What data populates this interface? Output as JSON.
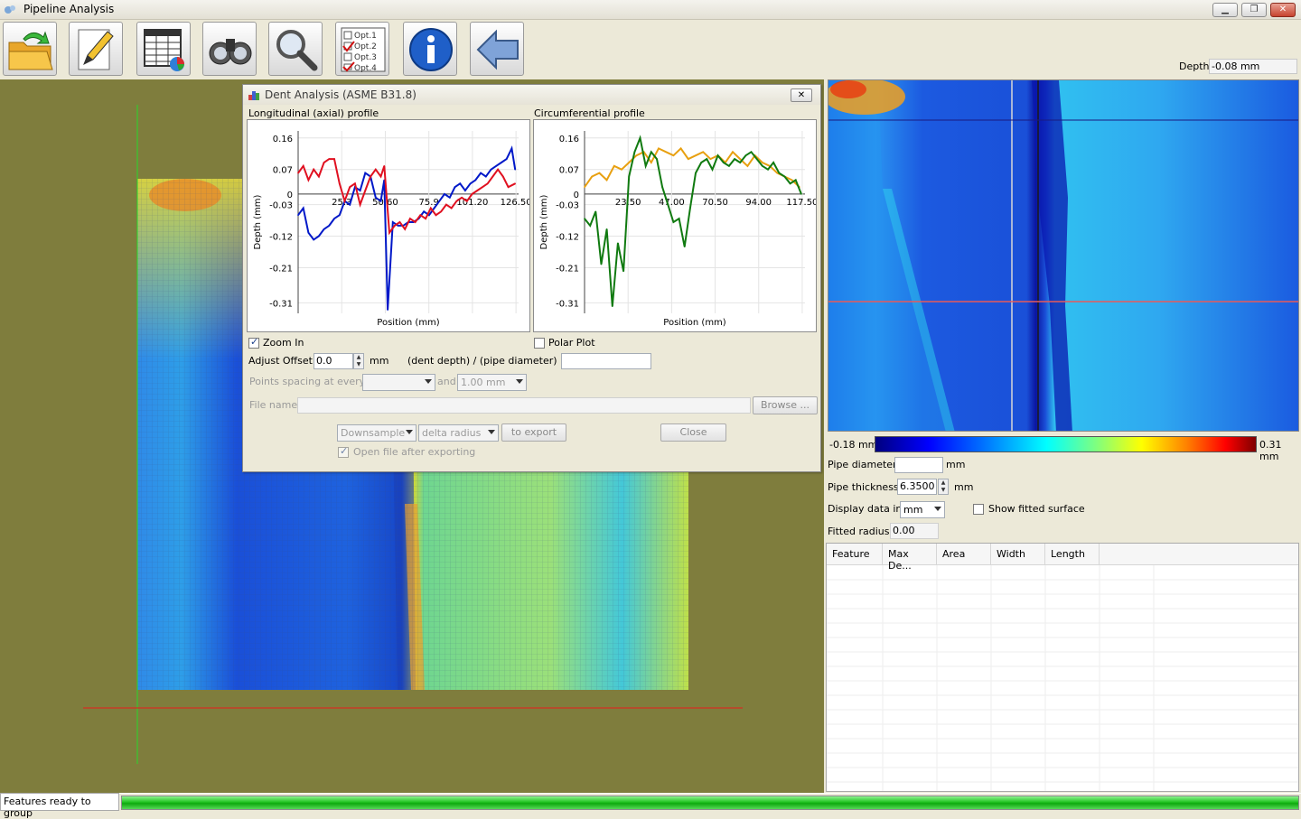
{
  "window": {
    "title": "Pipeline Analysis",
    "min_label": "▁",
    "max_label": "❐",
    "close_label": "✕"
  },
  "toolbar": {
    "buttons": [
      "open-folder-icon",
      "edit-pencil-icon",
      "table-report-icon",
      "binoculars-icon",
      "magnifier-icon",
      "options-checklist-icon",
      "info-icon",
      "back-arrow-icon"
    ],
    "options_labels": [
      "Opt.1",
      "Opt.2",
      "Opt.3",
      "Opt.4"
    ]
  },
  "depth": {
    "label": "Depth",
    "value": "-0.08 mm"
  },
  "dialog": {
    "title": "Dent Analysis (ASME B31.8)",
    "close_label": "✕",
    "long_title": "Longitudinal (axial) profile",
    "circ_title": "Circumferential profile",
    "y_label": "Depth (mm)",
    "x_label": "Position (mm)",
    "zoom_in_label": "Zoom In",
    "zoom_in_checked": true,
    "polar_plot_label": "Polar Plot",
    "polar_plot_checked": false,
    "adjust_offset_label": "Adjust Offset",
    "adjust_offset_value": "0.0",
    "adjust_offset_unit": "mm",
    "ratio_label": "(dent depth) / (pipe diameter) =",
    "ratio_value": "",
    "spacing_label": "Points spacing at every",
    "spacing_value": "",
    "and_label": "and",
    "spacing_value2": "1.00 mm",
    "file_name_label": "File name",
    "file_name_value": "",
    "browse_label": "Browse ...",
    "downsample_label": "Downsample",
    "delta_radius_label": "delta radius",
    "to_export_label": "to export",
    "close_button_label": "Close",
    "open_after_export_label": "Open file after exporting",
    "open_after_export_checked": true
  },
  "chart_data": [
    {
      "type": "line",
      "title": "Longitudinal (axial) profile",
      "xlabel": "Position (mm)",
      "ylabel": "Depth (mm)",
      "y_ticks": [
        "0.16",
        "0.07",
        "0",
        "-0.03",
        "-0.12",
        "-0.21",
        "-0.31"
      ],
      "x_ticks": [
        "25.3",
        "50.60",
        "75.9",
        "101.20",
        "126.50"
      ],
      "ylim": [
        -0.34,
        0.18
      ],
      "xlim": [
        0,
        128
      ],
      "series": [
        {
          "color": "#0018c8",
          "x": [
            0,
            3,
            6,
            9,
            12,
            15,
            18,
            21,
            24,
            27,
            30,
            33,
            36,
            39,
            42,
            45,
            48,
            50,
            52,
            55,
            58,
            61,
            64,
            67,
            70,
            73,
            76,
            79,
            82,
            85,
            88,
            91,
            94,
            97,
            100,
            103,
            106,
            109,
            112,
            115,
            118,
            121,
            124,
            126
          ],
          "values": [
            -0.06,
            -0.04,
            -0.11,
            -0.13,
            -0.12,
            -0.1,
            -0.09,
            -0.07,
            -0.06,
            -0.02,
            -0.03,
            0.02,
            0.01,
            0.06,
            0.05,
            -0.01,
            -0.02,
            0.04,
            -0.33,
            -0.08,
            -0.09,
            -0.09,
            -0.08,
            -0.08,
            -0.07,
            -0.05,
            -0.06,
            -0.04,
            -0.02,
            0.0,
            -0.01,
            0.02,
            0.03,
            0.01,
            0.03,
            0.04,
            0.06,
            0.05,
            0.07,
            0.08,
            0.09,
            0.1,
            0.13,
            0.07
          ]
        },
        {
          "color": "#e01020",
          "x": [
            0,
            3,
            6,
            9,
            12,
            15,
            18,
            21,
            24,
            27,
            30,
            33,
            36,
            39,
            42,
            45,
            48,
            50,
            53,
            56,
            59,
            62,
            65,
            68,
            71,
            74,
            77,
            80,
            83,
            86,
            89,
            92,
            95,
            98,
            101,
            104,
            107,
            110,
            113,
            116,
            119,
            122,
            126
          ],
          "values": [
            0.06,
            0.08,
            0.04,
            0.07,
            0.05,
            0.09,
            0.1,
            0.1,
            0.03,
            -0.02,
            0.02,
            0.03,
            -0.03,
            0.01,
            0.05,
            0.07,
            0.05,
            0.08,
            -0.11,
            -0.09,
            -0.08,
            -0.1,
            -0.07,
            -0.08,
            -0.06,
            -0.07,
            -0.04,
            -0.06,
            -0.05,
            -0.03,
            -0.04,
            -0.02,
            -0.01,
            -0.02,
            0.0,
            0.01,
            0.02,
            0.03,
            0.05,
            0.07,
            0.05,
            0.02,
            0.03
          ]
        }
      ]
    },
    {
      "type": "line",
      "title": "Circumferential profile",
      "xlabel": "Position (mm)",
      "ylabel": "Depth (mm)",
      "y_ticks": [
        "0.16",
        "0.07",
        "0",
        "-0.03",
        "-0.12",
        "-0.21",
        "-0.31"
      ],
      "x_ticks": [
        "23.50",
        "47.00",
        "70.50",
        "94.00",
        "117.50"
      ],
      "ylim": [
        -0.34,
        0.18
      ],
      "xlim": [
        0,
        119
      ],
      "series": [
        {
          "color": "#e8a010",
          "x": [
            0,
            4,
            8,
            12,
            16,
            20,
            24,
            28,
            32,
            36,
            40,
            44,
            48,
            52,
            56,
            60,
            64,
            68,
            72,
            76,
            80,
            84,
            88,
            92,
            96,
            100,
            104,
            108,
            112,
            116
          ],
          "values": [
            0.02,
            0.05,
            0.06,
            0.04,
            0.08,
            0.07,
            0.09,
            0.11,
            0.12,
            0.09,
            0.13,
            0.12,
            0.11,
            0.13,
            0.1,
            0.11,
            0.12,
            0.1,
            0.11,
            0.09,
            0.12,
            0.1,
            0.08,
            0.11,
            0.09,
            0.08,
            0.06,
            0.05,
            0.04,
            0.02
          ]
        },
        {
          "color": "#107a10",
          "x": [
            0,
            3,
            6,
            9,
            12,
            15,
            18,
            21,
            24,
            27,
            30,
            33,
            36,
            39,
            42,
            45,
            48,
            51,
            54,
            57,
            60,
            63,
            66,
            69,
            72,
            75,
            78,
            81,
            84,
            87,
            90,
            93,
            96,
            99,
            102,
            105,
            108,
            111,
            114,
            117
          ],
          "values": [
            -0.07,
            -0.09,
            -0.05,
            -0.2,
            -0.1,
            -0.32,
            -0.14,
            -0.22,
            0.05,
            0.12,
            0.16,
            0.08,
            0.12,
            0.1,
            0.02,
            -0.03,
            -0.08,
            -0.07,
            -0.15,
            -0.04,
            0.06,
            0.09,
            0.1,
            0.07,
            0.11,
            0.09,
            0.08,
            0.1,
            0.09,
            0.11,
            0.12,
            0.1,
            0.08,
            0.07,
            0.09,
            0.06,
            0.05,
            0.03,
            0.04,
            0.0
          ]
        }
      ]
    }
  ],
  "colorbar": {
    "min_label": "-0.18 mm",
    "max_label": "0.31 mm"
  },
  "props": {
    "pipe_diameter_label": "Pipe diameter",
    "pipe_diameter_value": "",
    "pipe_diameter_unit": "mm",
    "pipe_thickness_label": "Pipe thickness",
    "pipe_thickness_value": "6.3500",
    "pipe_thickness_unit": "mm",
    "display_data_label": "Display data in",
    "display_data_value": "mm",
    "show_fitted_label": "Show fitted surface",
    "show_fitted_checked": false,
    "fitted_radius_label": "Fitted radius",
    "fitted_radius_value": "0.00"
  },
  "table": {
    "columns": [
      "Feature",
      "Max De...",
      "Area",
      "Width",
      "Length"
    ],
    "rows": []
  },
  "status": {
    "text": "Features ready to group",
    "progress": 1.0
  }
}
